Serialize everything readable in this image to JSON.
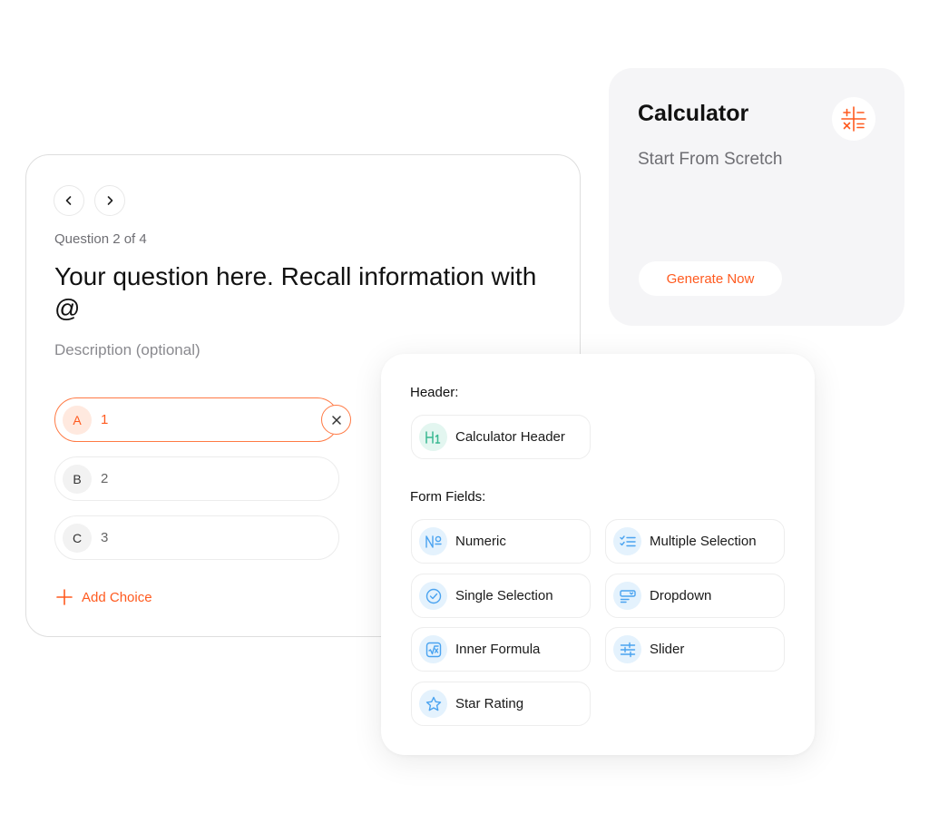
{
  "calculator_card": {
    "title": "Calculator",
    "subtitle": "Start From Scretch",
    "icon": "calculator-operations-icon",
    "generate_label": "Generate Now"
  },
  "question_card": {
    "nav": {
      "prev_icon": "chevron-left-icon",
      "next_icon": "chevron-right-icon"
    },
    "counter": "Question 2 of 4",
    "title": "Your question here. Recall information with @",
    "description_placeholder": "Description (optional)",
    "choices": [
      {
        "letter": "A",
        "value": "1",
        "active": true
      },
      {
        "letter": "B",
        "value": "2",
        "active": false
      },
      {
        "letter": "C",
        "value": "3",
        "active": false
      }
    ],
    "remove_icon": "close-icon",
    "add_choice_label": "Add Choice"
  },
  "field_picker": {
    "header_section_label": "Header:",
    "header_items": [
      {
        "label": "Calculator Header",
        "icon": "heading-1-icon"
      }
    ],
    "form_fields_label": "Form Fields:",
    "form_fields": [
      {
        "label": "Numeric",
        "icon": "numero-sign-icon"
      },
      {
        "label": "Multiple Selection",
        "icon": "checklist-icon"
      },
      {
        "label": "Single Selection",
        "icon": "check-circle-icon"
      },
      {
        "label": "Dropdown",
        "icon": "dropdown-icon"
      },
      {
        "label": "Inner Formula",
        "icon": "square-root-icon"
      },
      {
        "label": "Slider",
        "icon": "sliders-icon"
      },
      {
        "label": "Star Rating",
        "icon": "star-icon"
      }
    ]
  },
  "colors": {
    "accent": "#ff5a1f",
    "accent_border": "#ff7a45",
    "field_icon_blue": "#4aa3f0",
    "field_icon_green": "#3bb891",
    "card_gray": "#f5f5f7"
  }
}
